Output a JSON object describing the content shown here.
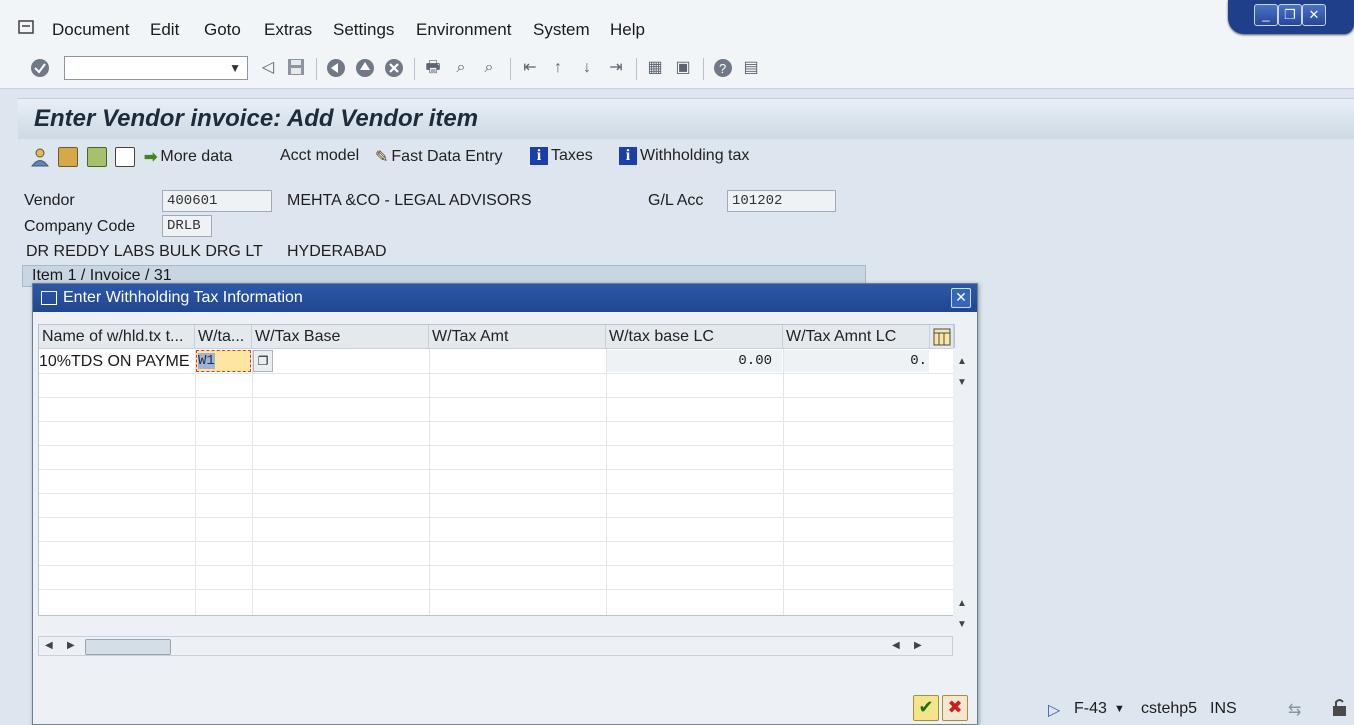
{
  "menu": {
    "items": [
      "Document",
      "Edit",
      "Goto",
      "Extras",
      "Settings",
      "Environment",
      "System",
      "Help"
    ]
  },
  "window_controls": [
    "minimize",
    "restore",
    "close"
  ],
  "screen": {
    "title": "Enter Vendor invoice: Add Vendor item"
  },
  "app_toolbar": {
    "more_data": "More data",
    "acct_model": "Acct model",
    "fast_data_entry": "Fast Data Entry",
    "taxes": "Taxes",
    "withholding_tax": "Withholding tax"
  },
  "header": {
    "vendor_label": "Vendor",
    "vendor_value": "400601",
    "vendor_name": "MEHTA &CO - LEGAL ADVISORS",
    "gl_label": "G/L Acc",
    "gl_value": "101202",
    "company_code_label": "Company Code",
    "company_code_value": "DRLB",
    "company_name": "DR REDDY LABS BULK DRG LT",
    "city": "HYDERABAD",
    "item_info": "Item 1 / Invoice / 31"
  },
  "dialog": {
    "title": "Enter Withholding Tax Information",
    "columns": [
      "Name of w/hld.tx t...",
      "W/ta...",
      "W/Tax Base",
      "W/Tax Amt",
      "W/tax base LC",
      "W/Tax Amnt LC"
    ],
    "rows": [
      {
        "name": "10%TDS ON PAYME",
        "code": "W1",
        "tax_base": "",
        "tax_amt": "",
        "tax_base_lc": "0.00",
        "tax_amt_lc": "0."
      }
    ]
  },
  "status_bar": {
    "transaction": "F-43",
    "server": "cstehp5",
    "mode": "INS"
  },
  "colors": {
    "dialog_title": "#2c58a8",
    "selected_cell": "#fde7a0",
    "background": "#dde6ee"
  }
}
